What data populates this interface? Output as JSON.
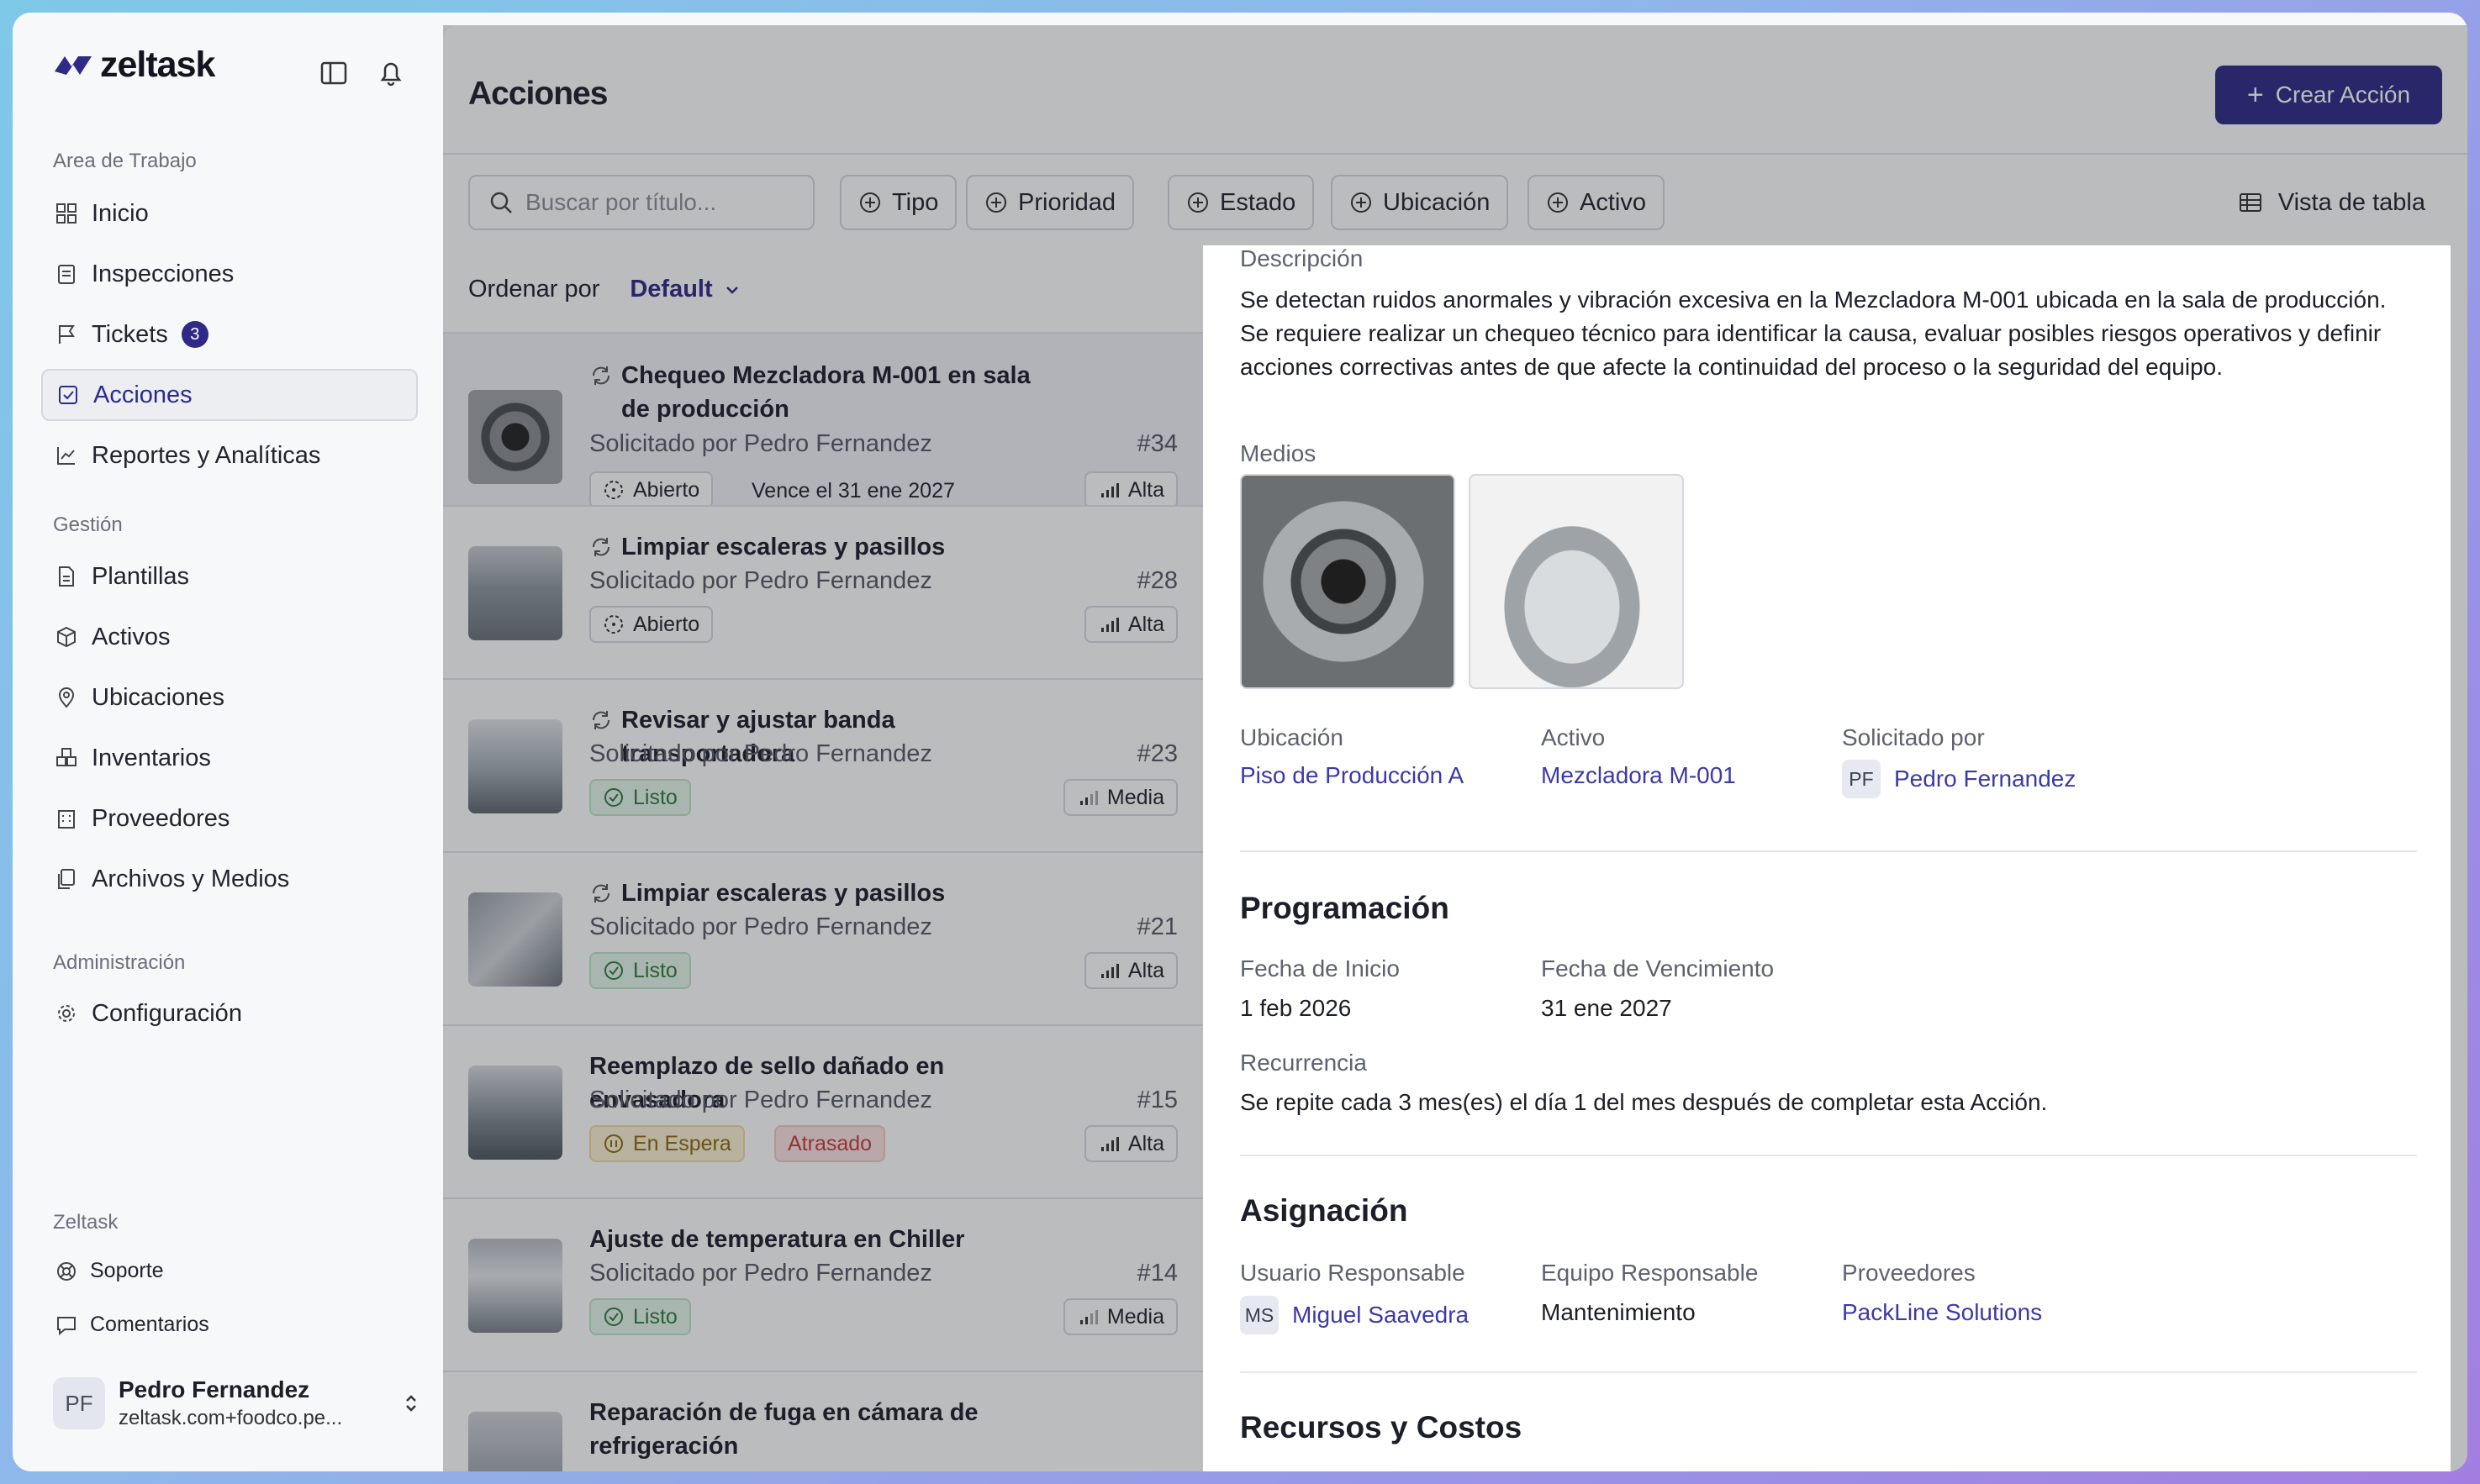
{
  "app": {
    "name": "zeltask"
  },
  "sidebar": {
    "section_workspace": "Area de Trabajo",
    "items": [
      {
        "label": "Inicio"
      },
      {
        "label": "Inspecciones"
      },
      {
        "label": "Tickets",
        "badge": "3"
      },
      {
        "label": "Acciones"
      },
      {
        "label": "Reportes y Analíticas"
      }
    ],
    "section_management": "Gestión",
    "management_items": [
      {
        "label": "Plantillas"
      },
      {
        "label": "Activos"
      },
      {
        "label": "Ubicaciones"
      },
      {
        "label": "Inventarios"
      },
      {
        "label": "Proveedores"
      },
      {
        "label": "Archivos y Medios"
      }
    ],
    "section_admin": "Administración",
    "admin_items": [
      {
        "label": "Configuración"
      }
    ],
    "section_footer": "Zeltask",
    "footer_items": [
      {
        "label": "Soporte"
      },
      {
        "label": "Comentarios"
      }
    ],
    "user": {
      "initials": "PF",
      "name": "Pedro Fernandez",
      "email": "zeltask.com+foodco.pe..."
    }
  },
  "header": {
    "title": "Acciones",
    "create_label": "Crear Acción"
  },
  "toolbar": {
    "search_placeholder": "Buscar por título...",
    "filters": [
      "Tipo",
      "Prioridad",
      "Estado",
      "Ubicación",
      "Activo"
    ],
    "view_label": "Vista de tabla",
    "sort_label": "Ordenar por",
    "sort_value": "Default"
  },
  "actions": [
    {
      "title": "Chequeo Mezcladora M-001 en sala de producción",
      "requested": "Solicitado por Pedro Fernandez",
      "num": "#34",
      "status": "Abierto",
      "due": "Vence el 31 ene 2027",
      "priority": "Alta"
    },
    {
      "title": "Limpiar escaleras y pasillos",
      "requested": "Solicitado por Pedro Fernandez",
      "num": "#28",
      "status": "Abierto",
      "priority": "Alta"
    },
    {
      "title": "Revisar y ajustar banda transportadora",
      "requested": "Solicitado por Pedro Fernandez",
      "num": "#23",
      "status": "Listo",
      "priority": "Media"
    },
    {
      "title": "Limpiar escaleras y pasillos",
      "requested": "Solicitado por Pedro Fernandez",
      "num": "#21",
      "status": "Listo",
      "priority": "Alta"
    },
    {
      "title": "Reemplazo de sello dañado en envasadora",
      "requested": "Solicitado por Pedro Fernandez",
      "num": "#15",
      "status": "En Espera",
      "extra": "Atrasado",
      "priority": "Alta"
    },
    {
      "title": "Ajuste de temperatura en Chiller",
      "requested": "Solicitado por Pedro Fernandez",
      "num": "#14",
      "status": "Listo",
      "priority": "Media"
    },
    {
      "title": "Reparación de fuga en cámara de refrigeración"
    }
  ],
  "detail": {
    "desc_label": "Descripción",
    "description": "Se detectan ruidos anormales y vibración excesiva en la Mezcladora M-001 ubicada en la sala de producción. Se requiere realizar un chequeo técnico para identificar la causa, evaluar posibles riesgos operativos y definir acciones correctivas antes de que afecte la continuidad del proceso o la seguridad del equipo.",
    "media_label": "Medios",
    "location_label": "Ubicación",
    "location": "Piso de Producción A",
    "asset_label": "Activo",
    "asset": "Mezcladora M-001",
    "requested_label": "Solicitado por",
    "requested_initials": "PF",
    "requested_by": "Pedro Fernandez",
    "schedule_title": "Programación",
    "start_label": "Fecha de Inicio",
    "start": "1 feb 2026",
    "due_label": "Fecha de Vencimiento",
    "due": "31 ene 2027",
    "recurrence_label": "Recurrencia",
    "recurrence": "Se repite cada 3 mes(es) el día 1 del mes después de completar esta Acción.",
    "assign_title": "Asignación",
    "owner_label": "Usuario Responsable",
    "owner_initials": "MS",
    "owner": "Miguel Saavedra",
    "team_label": "Equipo Responsable",
    "team": "Mantenimiento",
    "vendors_label": "Proveedores",
    "vendor": "PackLine Solutions",
    "resources_title": "Recursos y Costos"
  },
  "colors": {
    "accent": "#2e2a86",
    "link": "#3b3aa8"
  }
}
